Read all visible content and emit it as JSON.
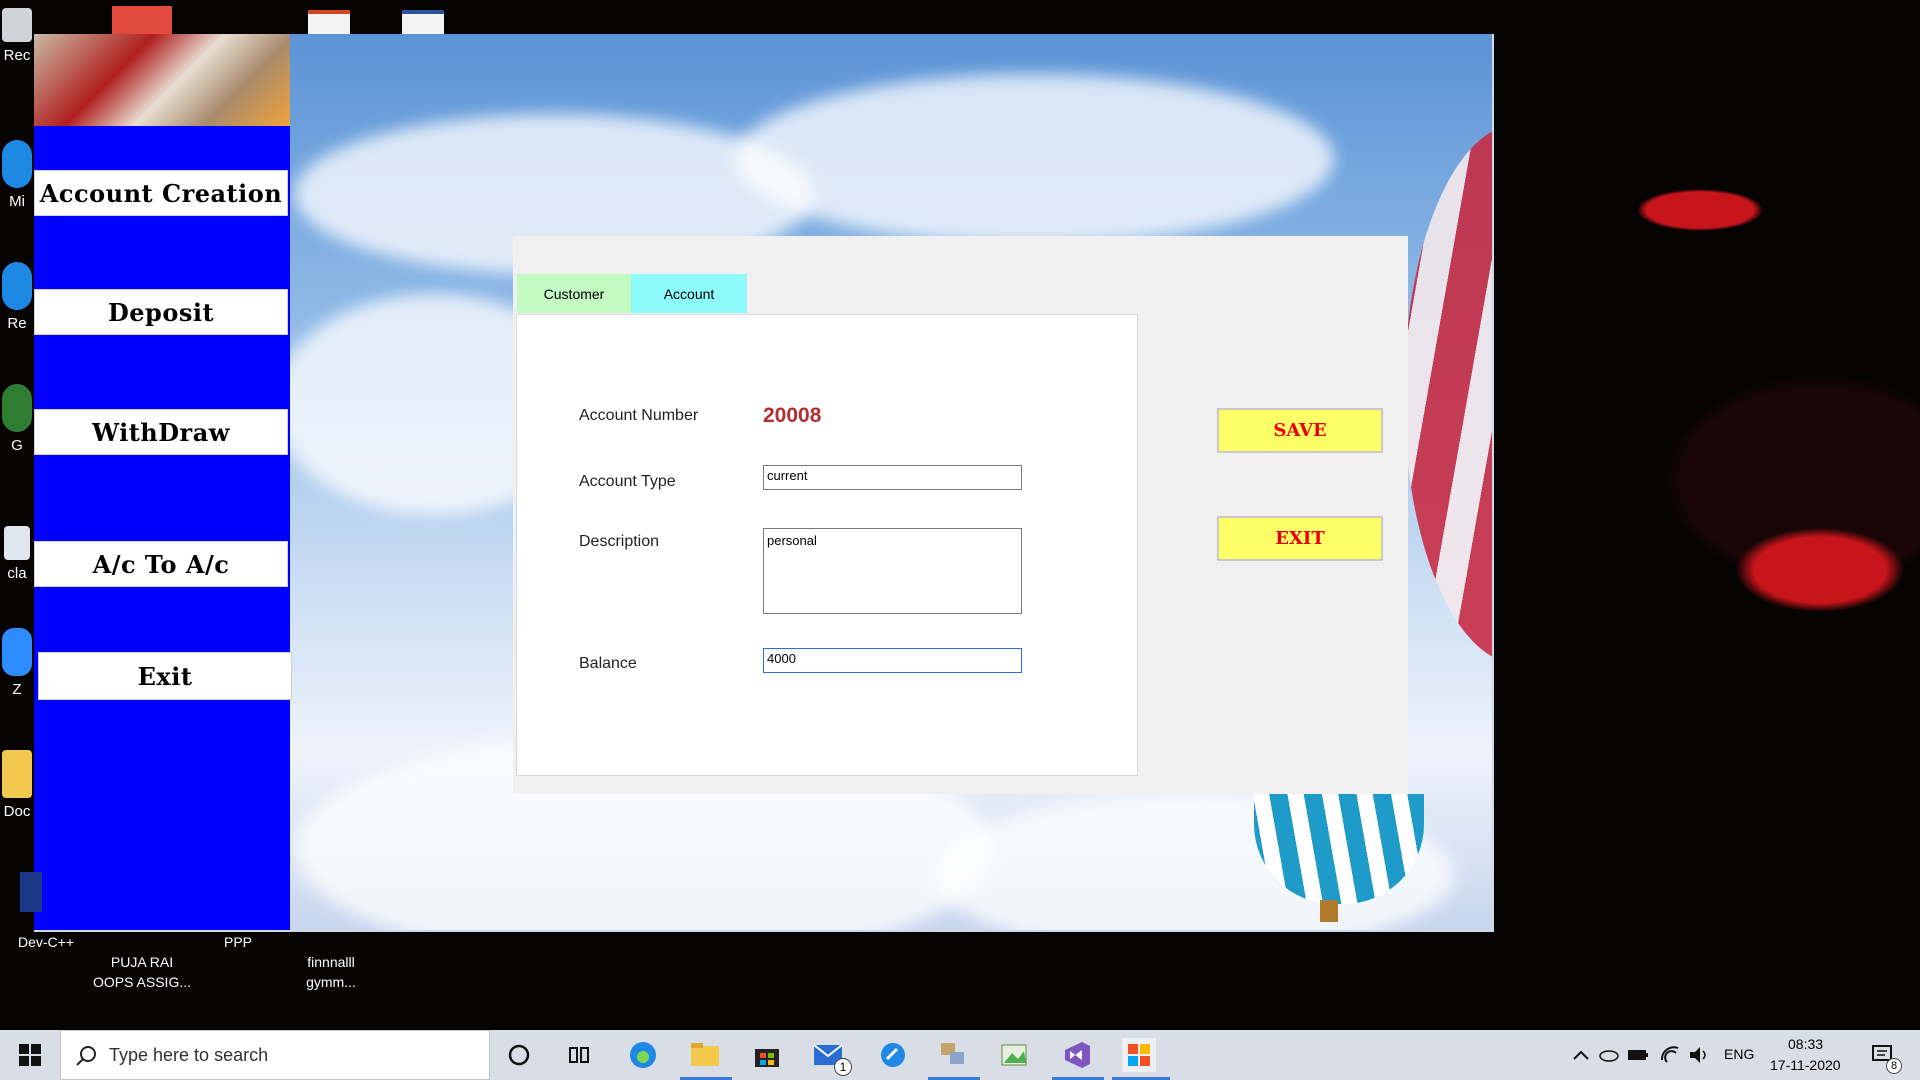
{
  "desktop": {
    "left_icons": [
      {
        "label": "Rec"
      },
      {
        "label": "Mi"
      },
      {
        "label": "Re"
      },
      {
        "label": "G"
      },
      {
        "label": "cla"
      },
      {
        "label": "Z"
      },
      {
        "label": "Doc"
      }
    ],
    "bottom_icons": [
      {
        "label": "Dev-C++"
      },
      {
        "label": "PUJA RAI\nOOPS ASSIG..."
      },
      {
        "label": "PPP"
      },
      {
        "label": "finnnalll\ngymm..."
      }
    ]
  },
  "sidebar": {
    "buttons": [
      {
        "label": "Account Creation"
      },
      {
        "label": "Deposit"
      },
      {
        "label": "WithDraw"
      },
      {
        "label": "A/c To A/c"
      },
      {
        "label": "Exit"
      }
    ]
  },
  "form": {
    "tabs": [
      {
        "label": "Customer",
        "color": "#c2fac2"
      },
      {
        "label": "Account",
        "color": "#8efbfb",
        "active": true
      }
    ],
    "fields": {
      "account_number_label": "Account Number",
      "account_number_value": "20008",
      "account_type_label": "Account Type",
      "account_type_value": "current",
      "description_label": "Description",
      "description_value": "personal",
      "balance_label": "Balance",
      "balance_value": "4000"
    },
    "actions": {
      "save_label": "SAVE",
      "exit_label": "EXIT"
    }
  },
  "taskbar": {
    "search_placeholder": "Type here to search",
    "language": "ENG",
    "time": "08:33",
    "date": "17-11-2020",
    "mail_badge": "1",
    "notification_count": "8"
  },
  "colors": {
    "sidebar_bg": "#0000fd",
    "action_button_bg": "#ffff66",
    "action_button_text": "#e80000",
    "account_number_color": "#b03030"
  }
}
